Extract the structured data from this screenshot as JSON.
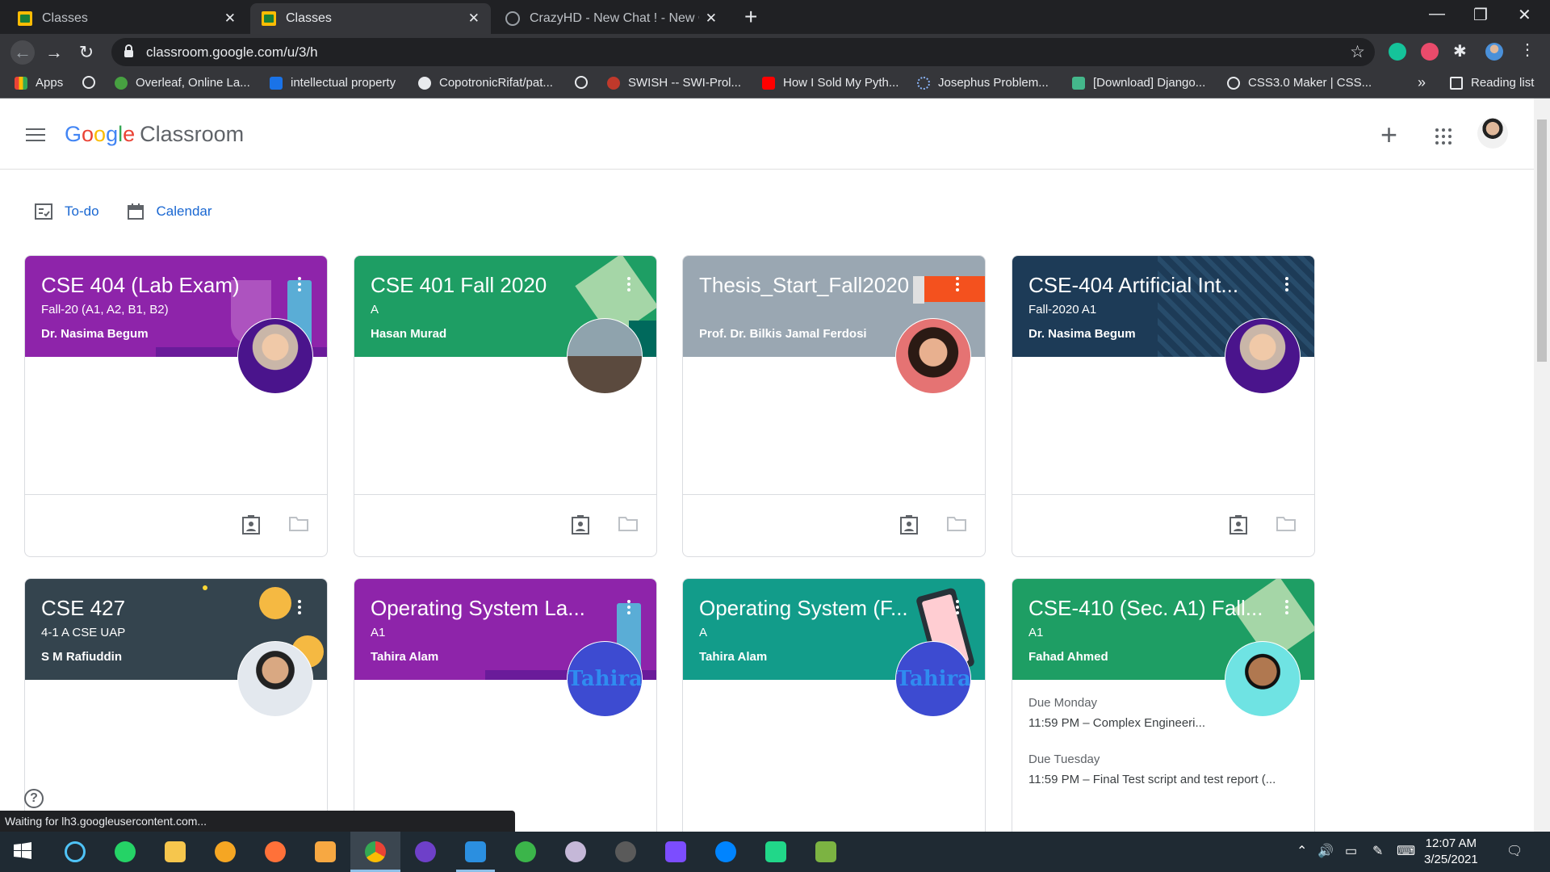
{
  "browser": {
    "tabs": [
      {
        "title": "Classes",
        "active": false
      },
      {
        "title": "Classes",
        "active": true
      },
      {
        "title": "CrazyHD - New Chat ! - New Chat",
        "active": false
      }
    ],
    "url": "classroom.google.com/u/3/h",
    "bookmarks": [
      "Apps",
      "",
      "Overleaf, Online La...",
      "intellectual property",
      "CopotronicRifat/pat...",
      "",
      "SWISH -- SWI-Prol...",
      "How I Sold My Pyth...",
      "Josephus Problem...",
      "[Download] Django...",
      "CSS3.0 Maker | CSS..."
    ],
    "bookmarks_more": "»",
    "reading_list": "Reading list"
  },
  "app": {
    "logo_google": [
      "G",
      "o",
      "o",
      "g",
      "l",
      "e"
    ],
    "logo_product": "Classroom",
    "todo_label": "To-do",
    "calendar_label": "Calendar"
  },
  "classes": [
    {
      "title": "CSE 404 (Lab Exam)",
      "section": "Fall-20 (A1, A2, B1, B2)",
      "teacher": "Dr. Nasima Begum",
      "color": "#8e24aa"
    },
    {
      "title": "CSE 401 Fall 2020",
      "section": "A",
      "teacher": "Hasan Murad",
      "color": "#1e9e64"
    },
    {
      "title": "Thesis_Start_Fall2020",
      "section": "",
      "teacher": "Prof. Dr. Bilkis Jamal Ferdosi",
      "color": "#9aa7b2"
    },
    {
      "title": "CSE-404 Artificial Int...",
      "section": "Fall-2020 A1",
      "teacher": "Dr. Nasima Begum",
      "color": "#1d3b57"
    },
    {
      "title": "CSE 427",
      "section": "4-1 A CSE UAP",
      "teacher": "S M Rafiuddin",
      "color": "#34444e"
    },
    {
      "title": "Operating System La...",
      "section": "A1",
      "teacher": "Tahira Alam",
      "color": "#8e24aa",
      "avatar_text": "Tahira"
    },
    {
      "title": "Operating System (F...",
      "section": "A",
      "teacher": "Tahira Alam",
      "color": "#129c8a",
      "avatar_text": "Tahira"
    },
    {
      "title": "CSE-410 (Sec. A1) Fall...",
      "section": "A1",
      "teacher": "Fahad Ahmed",
      "color": "#1e9e64",
      "due": [
        {
          "day": "Due Monday",
          "item": "11:59 PM – Complex Engineeri..."
        },
        {
          "day": "Due Tuesday",
          "item": "11:59 PM – Final Test script and test report (..."
        }
      ]
    }
  ],
  "status_text": "Waiting for lh3.googleusercontent.com...",
  "help_label": "?",
  "taskbar": {
    "time": "12:07 AM",
    "date": "3/25/2021"
  }
}
